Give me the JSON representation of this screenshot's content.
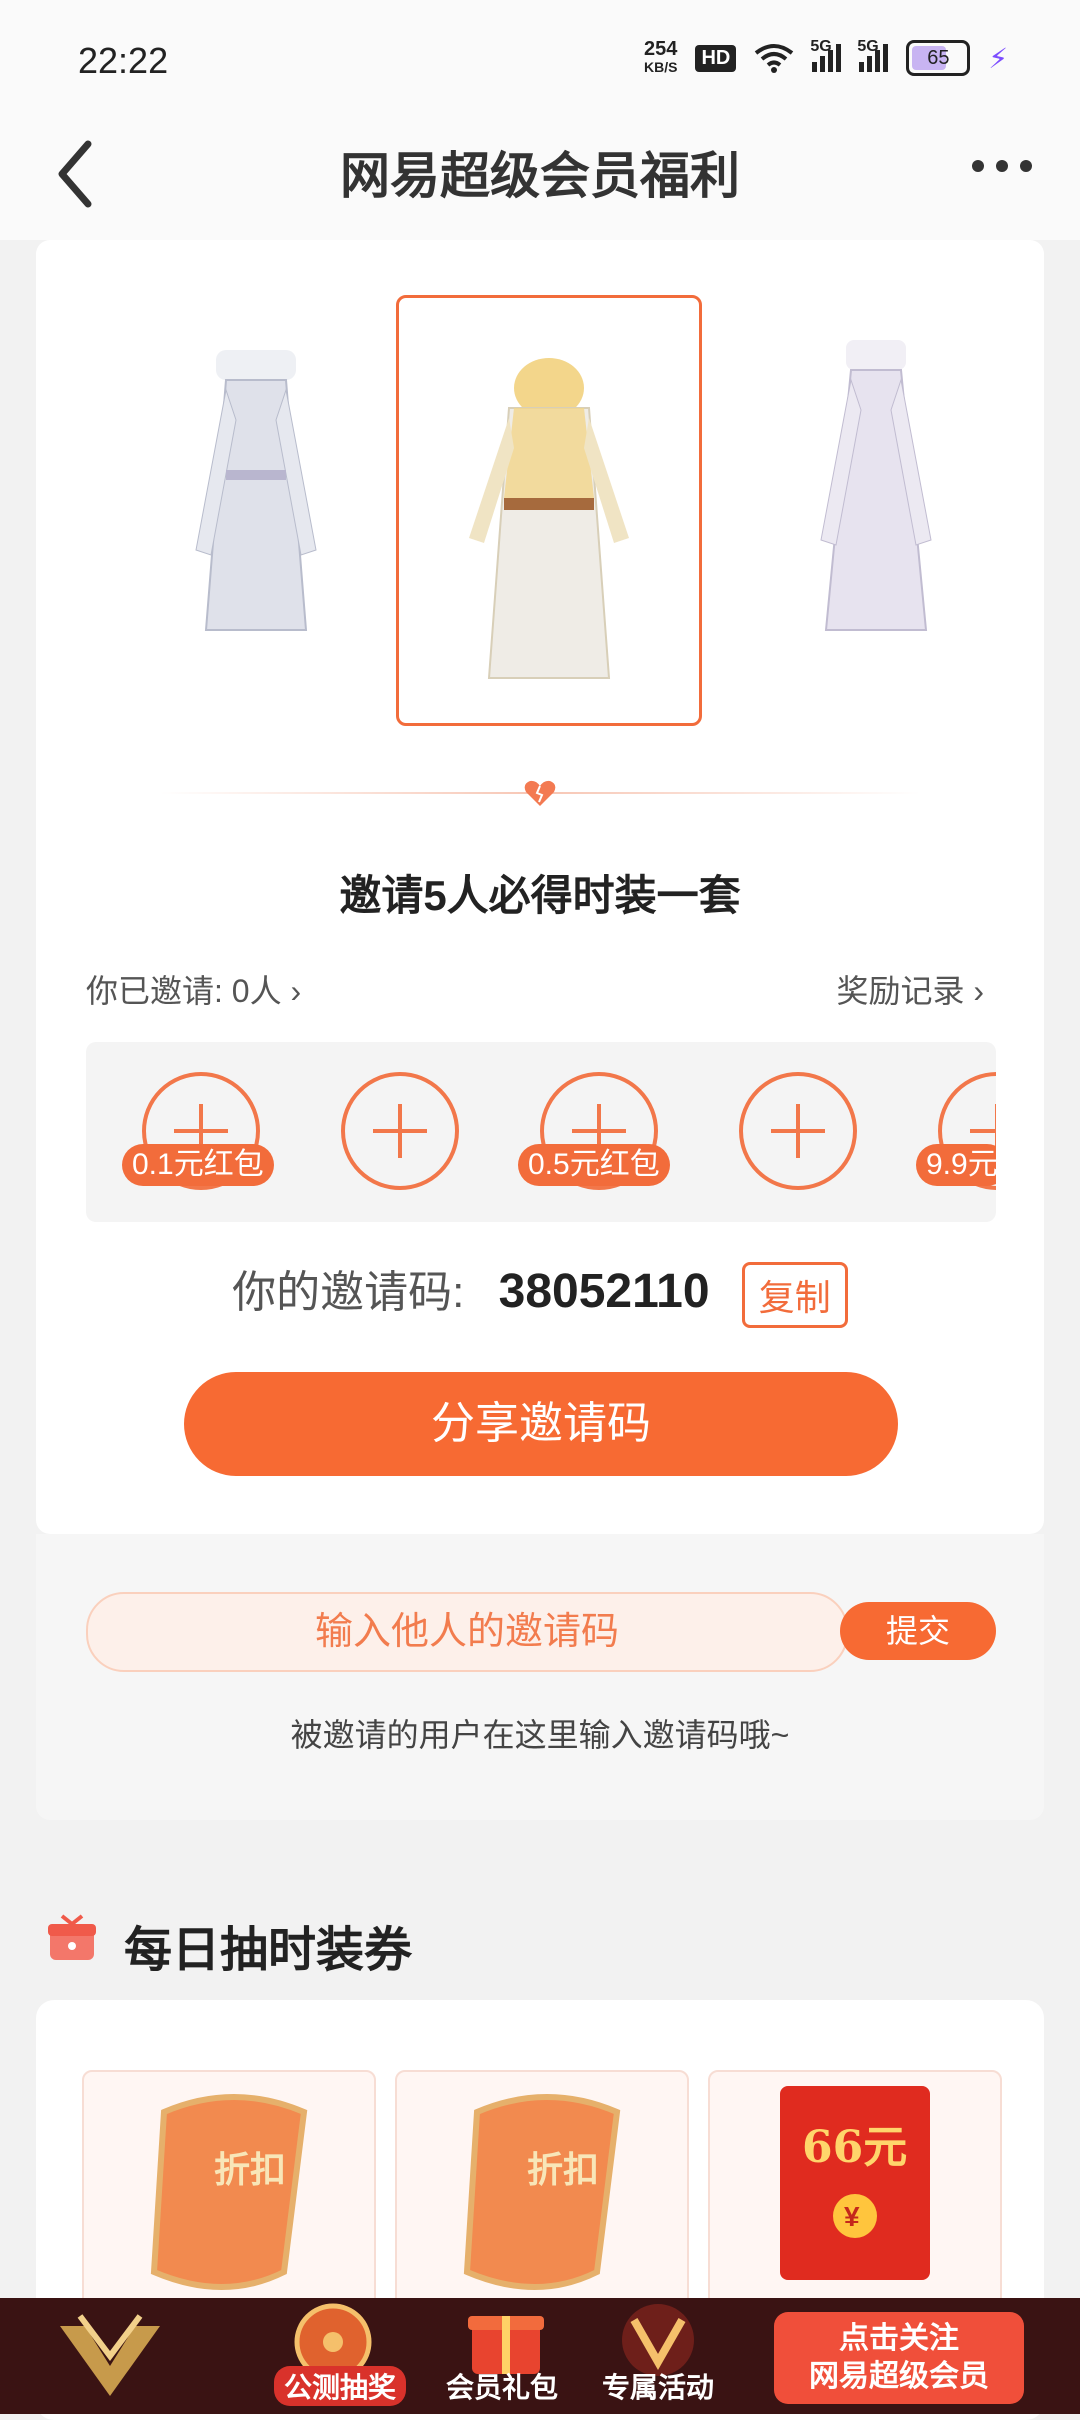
{
  "status_bar": {
    "time": "22:22",
    "net_speed_value": "254",
    "net_speed_unit": "KB/S",
    "hd_label": "HD",
    "signal_1_label": "5G",
    "signal_2_label": "5G",
    "battery": "65"
  },
  "header": {
    "title": "网易超级会员福利"
  },
  "invite": {
    "title": "邀请5人必得时装一套",
    "invited_label": "你已邀请: 0人 ›",
    "reward_record": "奖励记录 ›",
    "slot_badges": [
      "0.1元红包",
      "0.5元红包",
      "9.9元"
    ],
    "code_label": "你的邀请码:",
    "code_value": "38052110",
    "copy_label": "复制",
    "share_button": "分享邀请码"
  },
  "enter_code": {
    "placeholder": "输入他人的邀请码",
    "submit_label": "提交",
    "hint": "被邀请的用户在这里输入邀请码哦~"
  },
  "daily": {
    "title": "每日抽时装券",
    "ticket_1_text": "折扣",
    "ticket_2_text": "折扣",
    "red_packet_amount": "66元",
    "red_packet_symbol": "¥"
  },
  "bottom_bar": {
    "lottery": "公测抽奖",
    "gift": "会员礼包",
    "exclusive": "专属活动",
    "follow_line1": "点击关注",
    "follow_line2": "网易超级会员"
  },
  "colors": {
    "accent": "#f76a33",
    "bottom_bar": "#3a1313"
  }
}
